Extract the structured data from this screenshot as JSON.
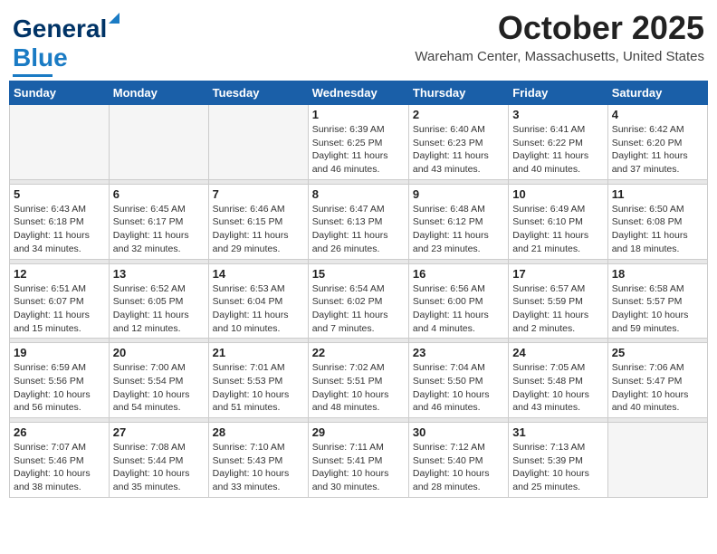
{
  "header": {
    "logo": {
      "general": "General",
      "blue": "Blue",
      "triangle": "▲"
    },
    "title": "October 2025",
    "location": "Wareham Center, Massachusetts, United States"
  },
  "calendar": {
    "days_of_week": [
      "Sunday",
      "Monday",
      "Tuesday",
      "Wednesday",
      "Thursday",
      "Friday",
      "Saturday"
    ],
    "weeks": [
      {
        "days": [
          {
            "num": "",
            "info": "",
            "empty": true
          },
          {
            "num": "",
            "info": "",
            "empty": true
          },
          {
            "num": "",
            "info": "",
            "empty": true
          },
          {
            "num": "1",
            "info": "Sunrise: 6:39 AM\nSunset: 6:25 PM\nDaylight: 11 hours\nand 46 minutes.",
            "empty": false
          },
          {
            "num": "2",
            "info": "Sunrise: 6:40 AM\nSunset: 6:23 PM\nDaylight: 11 hours\nand 43 minutes.",
            "empty": false
          },
          {
            "num": "3",
            "info": "Sunrise: 6:41 AM\nSunset: 6:22 PM\nDaylight: 11 hours\nand 40 minutes.",
            "empty": false
          },
          {
            "num": "4",
            "info": "Sunrise: 6:42 AM\nSunset: 6:20 PM\nDaylight: 11 hours\nand 37 minutes.",
            "empty": false
          }
        ]
      },
      {
        "days": [
          {
            "num": "5",
            "info": "Sunrise: 6:43 AM\nSunset: 6:18 PM\nDaylight: 11 hours\nand 34 minutes.",
            "empty": false
          },
          {
            "num": "6",
            "info": "Sunrise: 6:45 AM\nSunset: 6:17 PM\nDaylight: 11 hours\nand 32 minutes.",
            "empty": false
          },
          {
            "num": "7",
            "info": "Sunrise: 6:46 AM\nSunset: 6:15 PM\nDaylight: 11 hours\nand 29 minutes.",
            "empty": false
          },
          {
            "num": "8",
            "info": "Sunrise: 6:47 AM\nSunset: 6:13 PM\nDaylight: 11 hours\nand 26 minutes.",
            "empty": false
          },
          {
            "num": "9",
            "info": "Sunrise: 6:48 AM\nSunset: 6:12 PM\nDaylight: 11 hours\nand 23 minutes.",
            "empty": false
          },
          {
            "num": "10",
            "info": "Sunrise: 6:49 AM\nSunset: 6:10 PM\nDaylight: 11 hours\nand 21 minutes.",
            "empty": false
          },
          {
            "num": "11",
            "info": "Sunrise: 6:50 AM\nSunset: 6:08 PM\nDaylight: 11 hours\nand 18 minutes.",
            "empty": false
          }
        ]
      },
      {
        "days": [
          {
            "num": "12",
            "info": "Sunrise: 6:51 AM\nSunset: 6:07 PM\nDaylight: 11 hours\nand 15 minutes.",
            "empty": false
          },
          {
            "num": "13",
            "info": "Sunrise: 6:52 AM\nSunset: 6:05 PM\nDaylight: 11 hours\nand 12 minutes.",
            "empty": false
          },
          {
            "num": "14",
            "info": "Sunrise: 6:53 AM\nSunset: 6:04 PM\nDaylight: 11 hours\nand 10 minutes.",
            "empty": false
          },
          {
            "num": "15",
            "info": "Sunrise: 6:54 AM\nSunset: 6:02 PM\nDaylight: 11 hours\nand 7 minutes.",
            "empty": false
          },
          {
            "num": "16",
            "info": "Sunrise: 6:56 AM\nSunset: 6:00 PM\nDaylight: 11 hours\nand 4 minutes.",
            "empty": false
          },
          {
            "num": "17",
            "info": "Sunrise: 6:57 AM\nSunset: 5:59 PM\nDaylight: 11 hours\nand 2 minutes.",
            "empty": false
          },
          {
            "num": "18",
            "info": "Sunrise: 6:58 AM\nSunset: 5:57 PM\nDaylight: 10 hours\nand 59 minutes.",
            "empty": false
          }
        ]
      },
      {
        "days": [
          {
            "num": "19",
            "info": "Sunrise: 6:59 AM\nSunset: 5:56 PM\nDaylight: 10 hours\nand 56 minutes.",
            "empty": false
          },
          {
            "num": "20",
            "info": "Sunrise: 7:00 AM\nSunset: 5:54 PM\nDaylight: 10 hours\nand 54 minutes.",
            "empty": false
          },
          {
            "num": "21",
            "info": "Sunrise: 7:01 AM\nSunset: 5:53 PM\nDaylight: 10 hours\nand 51 minutes.",
            "empty": false
          },
          {
            "num": "22",
            "info": "Sunrise: 7:02 AM\nSunset: 5:51 PM\nDaylight: 10 hours\nand 48 minutes.",
            "empty": false
          },
          {
            "num": "23",
            "info": "Sunrise: 7:04 AM\nSunset: 5:50 PM\nDaylight: 10 hours\nand 46 minutes.",
            "empty": false
          },
          {
            "num": "24",
            "info": "Sunrise: 7:05 AM\nSunset: 5:48 PM\nDaylight: 10 hours\nand 43 minutes.",
            "empty": false
          },
          {
            "num": "25",
            "info": "Sunrise: 7:06 AM\nSunset: 5:47 PM\nDaylight: 10 hours\nand 40 minutes.",
            "empty": false
          }
        ]
      },
      {
        "days": [
          {
            "num": "26",
            "info": "Sunrise: 7:07 AM\nSunset: 5:46 PM\nDaylight: 10 hours\nand 38 minutes.",
            "empty": false
          },
          {
            "num": "27",
            "info": "Sunrise: 7:08 AM\nSunset: 5:44 PM\nDaylight: 10 hours\nand 35 minutes.",
            "empty": false
          },
          {
            "num": "28",
            "info": "Sunrise: 7:10 AM\nSunset: 5:43 PM\nDaylight: 10 hours\nand 33 minutes.",
            "empty": false
          },
          {
            "num": "29",
            "info": "Sunrise: 7:11 AM\nSunset: 5:41 PM\nDaylight: 10 hours\nand 30 minutes.",
            "empty": false
          },
          {
            "num": "30",
            "info": "Sunrise: 7:12 AM\nSunset: 5:40 PM\nDaylight: 10 hours\nand 28 minutes.",
            "empty": false
          },
          {
            "num": "31",
            "info": "Sunrise: 7:13 AM\nSunset: 5:39 PM\nDaylight: 10 hours\nand 25 minutes.",
            "empty": false
          },
          {
            "num": "",
            "info": "",
            "empty": true
          }
        ]
      }
    ]
  }
}
